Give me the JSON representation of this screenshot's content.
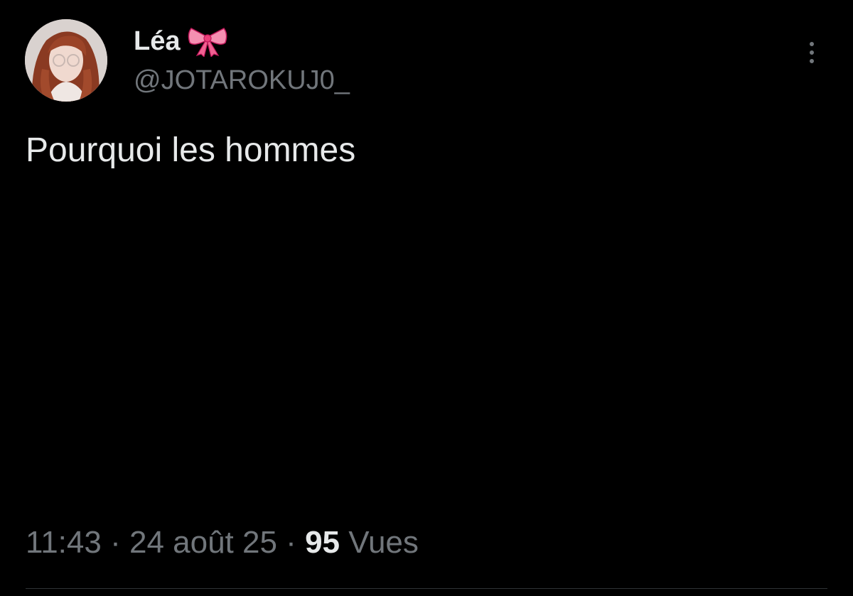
{
  "author": {
    "display_name": "Léa",
    "name_emoji": "ribbon-icon",
    "handle": "@JOTAROKUJ0_"
  },
  "tweet": {
    "text": "Pourquoi les hommes"
  },
  "meta": {
    "time": "11:43",
    "separator": "·",
    "date": "24 août 25",
    "views_count": "95",
    "views_label": "Vues"
  },
  "colors": {
    "background": "#000000",
    "primary_text": "#e7e9ea",
    "secondary_text": "#71767b",
    "ribbon": "#f48fb1"
  }
}
